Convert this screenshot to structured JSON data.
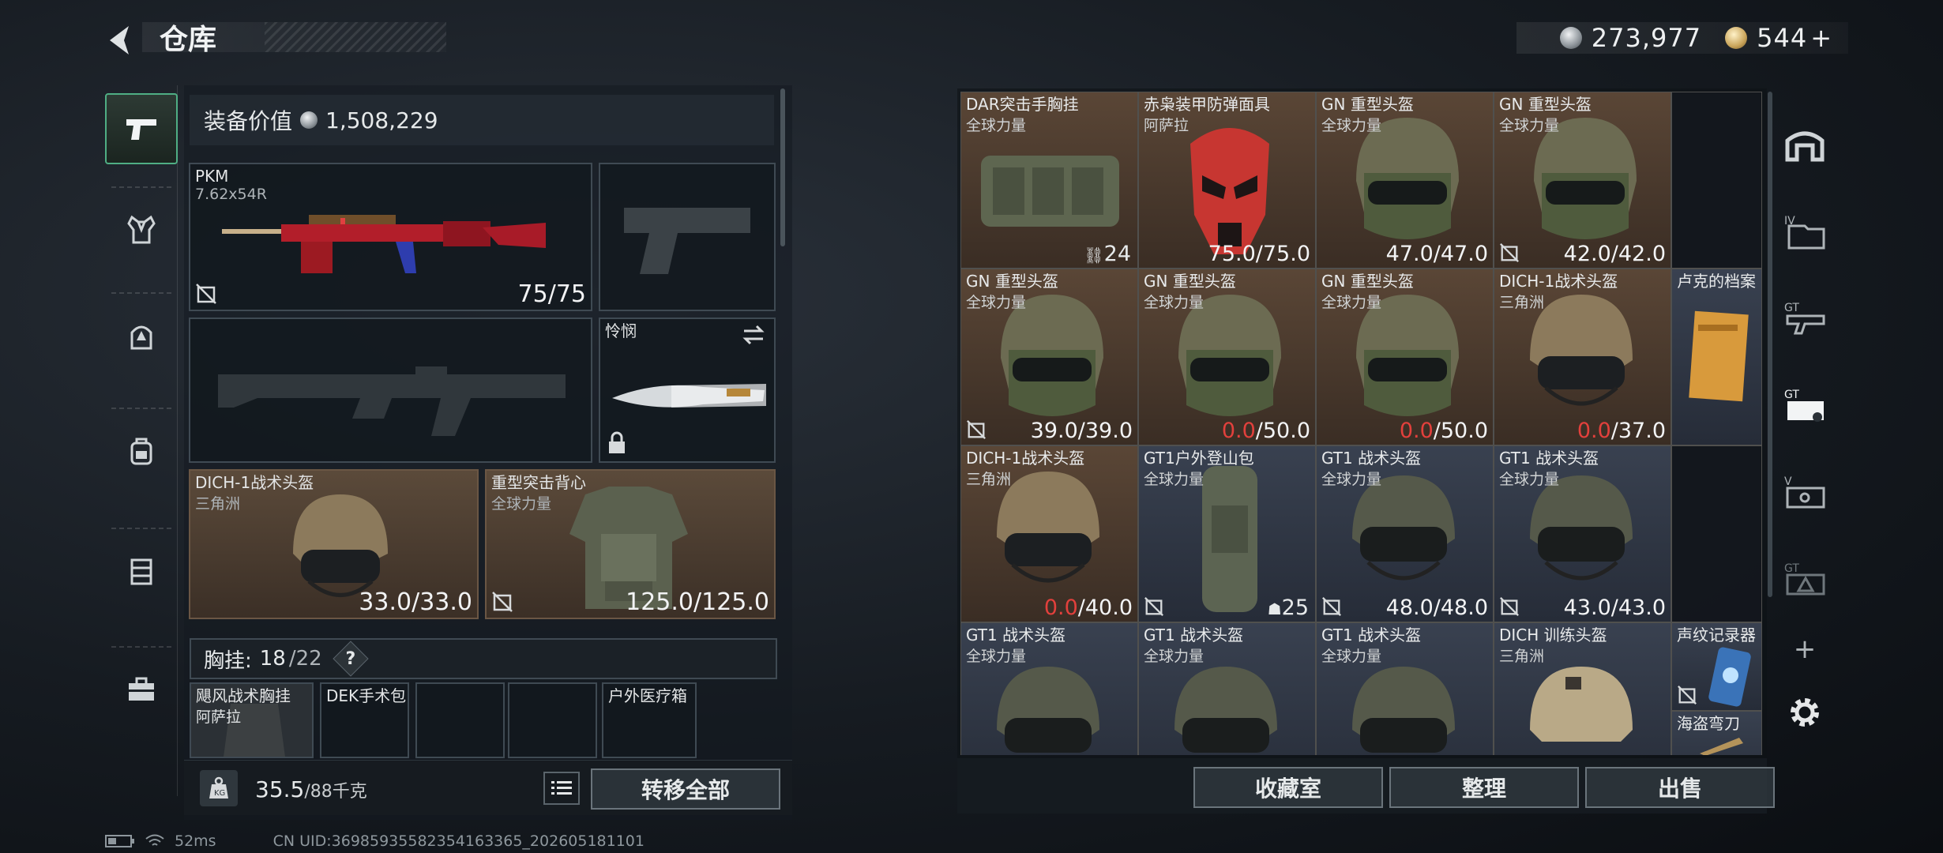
{
  "header": {
    "title": "仓库",
    "currency_primary": "273,977",
    "currency_secondary": "544",
    "currency_secondary_plus": "+"
  },
  "left_nav": {
    "items": [
      {
        "icon": "pistol-icon",
        "active": true
      },
      {
        "icon": "vest-icon",
        "active": false
      },
      {
        "icon": "helmet-armor-icon",
        "active": false
      },
      {
        "icon": "backpack-icon",
        "active": false
      },
      {
        "icon": "chest-rig-icon",
        "active": false
      },
      {
        "icon": "toolbox-icon",
        "active": false
      }
    ]
  },
  "equipment": {
    "value_label": "装备价值",
    "value": "1,508,229",
    "primary_weapon": {
      "name": "PKM",
      "caliber": "7.62x54R",
      "durability": "75/75"
    },
    "melee": {
      "name": "怜悯"
    },
    "helmet": {
      "name": "DICH-1战术头盔",
      "sub": "三角洲",
      "durability": "33.0/33.0"
    },
    "armor": {
      "name": "重型突击背心",
      "sub": "全球力量",
      "durability": "125.0/125.0"
    },
    "chest_rig_label": "胸挂:",
    "chest_rig_used": "18",
    "chest_rig_total": "/22",
    "chest_rig_help": "?",
    "rig_items": [
      {
        "name": "飓风战术胸挂",
        "sub": "阿萨拉"
      },
      {
        "name": "DEK手术包"
      },
      {
        "name": "户外医疗箱"
      }
    ],
    "weight_value": "35.5",
    "weight_total": "/88千克",
    "transfer_all": "转移全部"
  },
  "stash": {
    "items": [
      {
        "name": "DAR突击手胸挂",
        "sub": "全球力量",
        "count": "24",
        "color": "brown"
      },
      {
        "name": "赤枭装甲防弹面具",
        "sub": "阿萨拉",
        "dur_cur": "75.0",
        "dur_max": "/75.0",
        "color": "brown"
      },
      {
        "name": "GN 重型头盔",
        "sub": "全球力量",
        "dur_cur": "47.0",
        "dur_max": "/47.0",
        "color": "brown"
      },
      {
        "name": "GN 重型头盔",
        "sub": "全球力量",
        "dur_cur": "42.0",
        "dur_max": "/42.0",
        "color": "brown"
      },
      {
        "name": "GN 重型头盔",
        "sub": "全球力量",
        "dur_cur": "39.0",
        "dur_max": "/39.0",
        "color": "brown"
      },
      {
        "name": "GN 重型头盔",
        "sub": "全球力量",
        "dur_cur": "0.0",
        "dur_max": "/50.0",
        "color": "brown"
      },
      {
        "name": "GN 重型头盔",
        "sub": "全球力量",
        "dur_cur": "0.0",
        "dur_max": "/50.0",
        "color": "brown"
      },
      {
        "name": "DICH-1战术头盔",
        "sub": "三角洲",
        "dur_cur": "0.0",
        "dur_max": "/37.0",
        "color": "brown"
      },
      {
        "name": "卢克的档案",
        "color": "blue"
      },
      {
        "name": "DICH-1战术头盔",
        "sub": "三角洲",
        "dur_cur": "0.0",
        "dur_max": "/40.0",
        "color": "brown"
      },
      {
        "name": "GT1户外登山包",
        "sub": "全球力量",
        "count": "25",
        "color": "blue"
      },
      {
        "name": "GT1 战术头盔",
        "sub": "全球力量",
        "dur_cur": "48.0",
        "dur_max": "/48.0",
        "color": "blue"
      },
      {
        "name": "GT1 战术头盔",
        "sub": "全球力量",
        "dur_cur": "43.0",
        "dur_max": "/43.0",
        "color": "blue"
      },
      {
        "name": "GT1 战术头盔",
        "sub": "全球力量",
        "color": "blue"
      },
      {
        "name": "GT1 战术头盔",
        "sub": "全球力量",
        "color": "blue"
      },
      {
        "name": "GT1 战术头盔",
        "sub": "全球力量",
        "color": "blue"
      },
      {
        "name": "DICH 训练头盔",
        "sub": "三角洲",
        "color": "blue"
      },
      {
        "name": "声纹记录器",
        "color": "blue"
      },
      {
        "name": "海盗弯刀",
        "color": "blue"
      }
    ],
    "btn_collection": "收藏室",
    "btn_sort": "整理",
    "btn_sell": "出售"
  },
  "right_nav": {
    "items": [
      "house-icon",
      "iv-folder-icon",
      "gt-gun-icon",
      "gt-armor-icon",
      "v-case-icon",
      "gt-triangle-icon"
    ],
    "add_label": "+"
  },
  "footer": {
    "ping": "52ms",
    "uid": "CN UID:3698593558235416336​5_202605181101"
  },
  "colors": {
    "accent_green": "#4fae84",
    "durability_red": "#e2403c",
    "slot_brown": "#5a4636",
    "slot_blue": "#394150"
  }
}
